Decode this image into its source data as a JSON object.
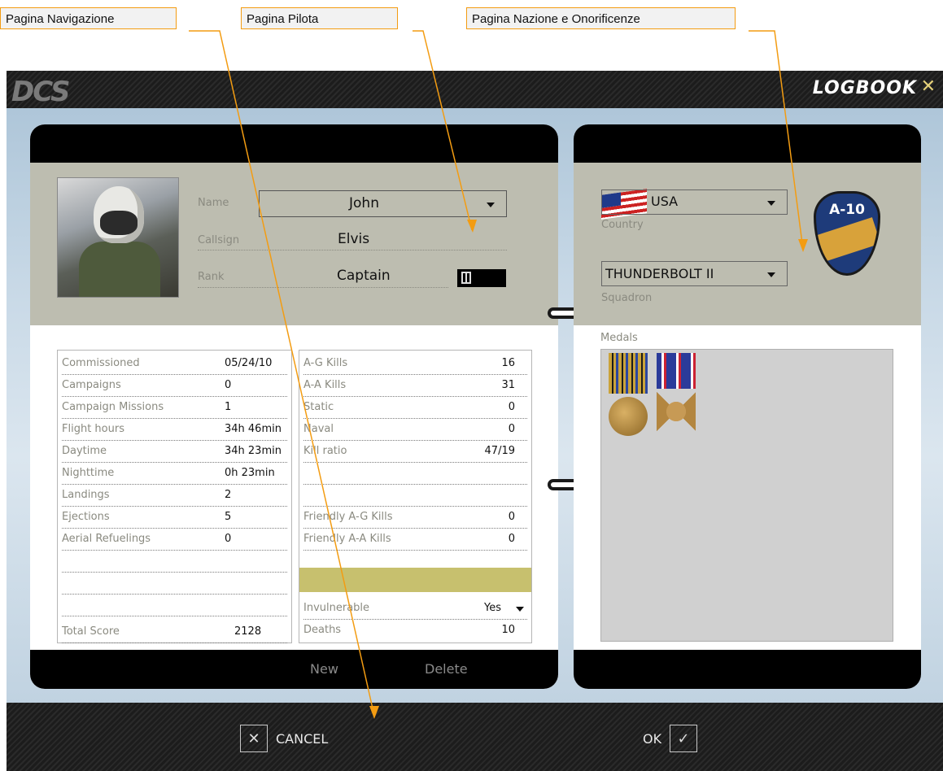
{
  "annotations": {
    "nav": "Pagina Navigazione",
    "pilot": "Pagina Pilota",
    "nation": "Pagina Nazione e Onorificenze"
  },
  "app": {
    "logo": "DCS",
    "title": "LOGBOOK",
    "close_glyph": "✕"
  },
  "pilot": {
    "name_label": "Name",
    "name_value": "John",
    "callsign_label": "Callsign",
    "callsign_value": "Elvis",
    "rank_label": "Rank",
    "rank_value": "Captain"
  },
  "stats_left": [
    {
      "label": "Commissioned",
      "value": "05/24/10"
    },
    {
      "label": "Campaigns",
      "value": "0"
    },
    {
      "label": "Campaign Missions",
      "value": "1"
    },
    {
      "label": "Flight hours",
      "value": "34h 46min"
    },
    {
      "label": "Daytime",
      "value": "34h 23min"
    },
    {
      "label": "Nighttime",
      "value": "0h 23min"
    },
    {
      "label": "Landings",
      "value": "2"
    },
    {
      "label": "Ejections",
      "value": "5"
    },
    {
      "label": "Aerial Refuelings",
      "value": "0"
    },
    {
      "label": "",
      "value": ""
    },
    {
      "label": "",
      "value": ""
    },
    {
      "label": "",
      "value": ""
    }
  ],
  "total_score": {
    "label": "Total Score",
    "value": "2128"
  },
  "stats_right": [
    {
      "label": "A-G Kills",
      "value": "16"
    },
    {
      "label": "A-A Kills",
      "value": "31"
    },
    {
      "label": "Static",
      "value": "0"
    },
    {
      "label": "Naval",
      "value": "0"
    },
    {
      "label": "Kill ratio",
      "value": "47/19"
    },
    {
      "label": "",
      "value": ""
    },
    {
      "label": "",
      "value": ""
    },
    {
      "label": "Friendly A-G Kills",
      "value": "0"
    },
    {
      "label": "Friendly A-A Kills",
      "value": "0"
    },
    {
      "label": "",
      "value": ""
    }
  ],
  "invulnerable": {
    "label": "Invulnerable",
    "value": "Yes"
  },
  "deaths": {
    "label": "Deaths",
    "value": "10"
  },
  "left_footer": {
    "new": "New",
    "delete": "Delete"
  },
  "nation": {
    "country_value": "USA",
    "country_label": "Country",
    "squadron_value": "THUNDERBOLT II",
    "squadron_label": "Squadron",
    "patch_text": "A-10",
    "medals_label": "Medals"
  },
  "bottom": {
    "cancel": "CANCEL",
    "ok": "OK"
  },
  "colors": {
    "accent": "#f39c12",
    "panel": "#bdbdb0",
    "highlight": "#c7c06e"
  }
}
